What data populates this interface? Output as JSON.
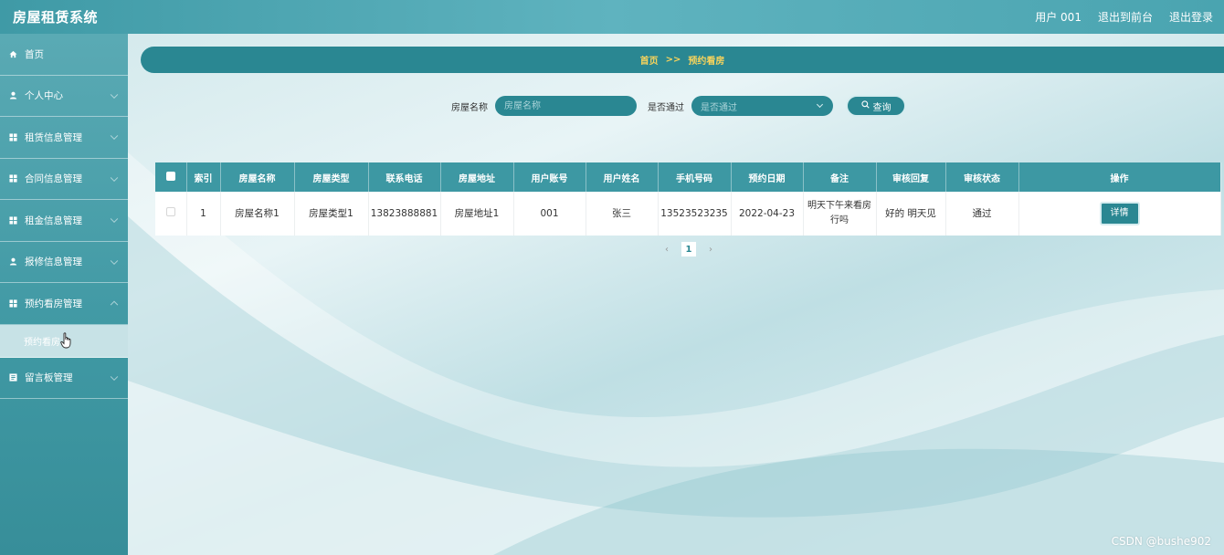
{
  "app": {
    "title": "房屋租赁系统"
  },
  "topbar": {
    "user": "用户 001",
    "back_front": "退出到前台",
    "logout": "退出登录"
  },
  "sidebar": {
    "items": [
      {
        "label": "首页",
        "icon": "home-icon",
        "expandable": false
      },
      {
        "label": "个人中心",
        "icon": "user-icon",
        "expandable": true
      },
      {
        "label": "租赁信息管理",
        "icon": "grid-icon",
        "expandable": true
      },
      {
        "label": "合同信息管理",
        "icon": "grid-icon",
        "expandable": true
      },
      {
        "label": "租金信息管理",
        "icon": "grid-icon",
        "expandable": true
      },
      {
        "label": "报修信息管理",
        "icon": "user-icon",
        "expandable": true
      },
      {
        "label": "预约看房管理",
        "icon": "grid-icon",
        "expandable": true
      },
      {
        "label": "留言板管理",
        "icon": "note-icon",
        "expandable": true
      }
    ],
    "active_sub": "预约看房"
  },
  "breadcrumb": {
    "home": "首页",
    "sep": ">>",
    "current": "预约看房"
  },
  "search": {
    "name_label": "房屋名称",
    "name_placeholder": "房屋名称",
    "pass_label": "是否通过",
    "pass_placeholder": "是否通过",
    "query_label": "查询"
  },
  "table": {
    "headers": [
      "索引",
      "房屋名称",
      "房屋类型",
      "联系电话",
      "房屋地址",
      "用户账号",
      "用户姓名",
      "手机号码",
      "预约日期",
      "备注",
      "审核回复",
      "审核状态",
      "操作"
    ],
    "rows": [
      {
        "index": "1",
        "house_name": "房屋名称1",
        "house_type": "房屋类型1",
        "phone": "13823888881",
        "address": "房屋地址1",
        "account": "001",
        "username": "张三",
        "mobile": "13523523235",
        "date": "2022-04-23",
        "remark": "明天下午来看房行吗",
        "reply": "好的 明天见",
        "status": "通过",
        "action": "详情"
      }
    ]
  },
  "pagination": {
    "prev": "‹",
    "current": "1",
    "next": "›"
  },
  "watermark": "CSDN @bushe902",
  "colors": {
    "accent": "#2a8792",
    "header": "#3d98a3",
    "breadcrumb_text": "#f6d35c"
  }
}
